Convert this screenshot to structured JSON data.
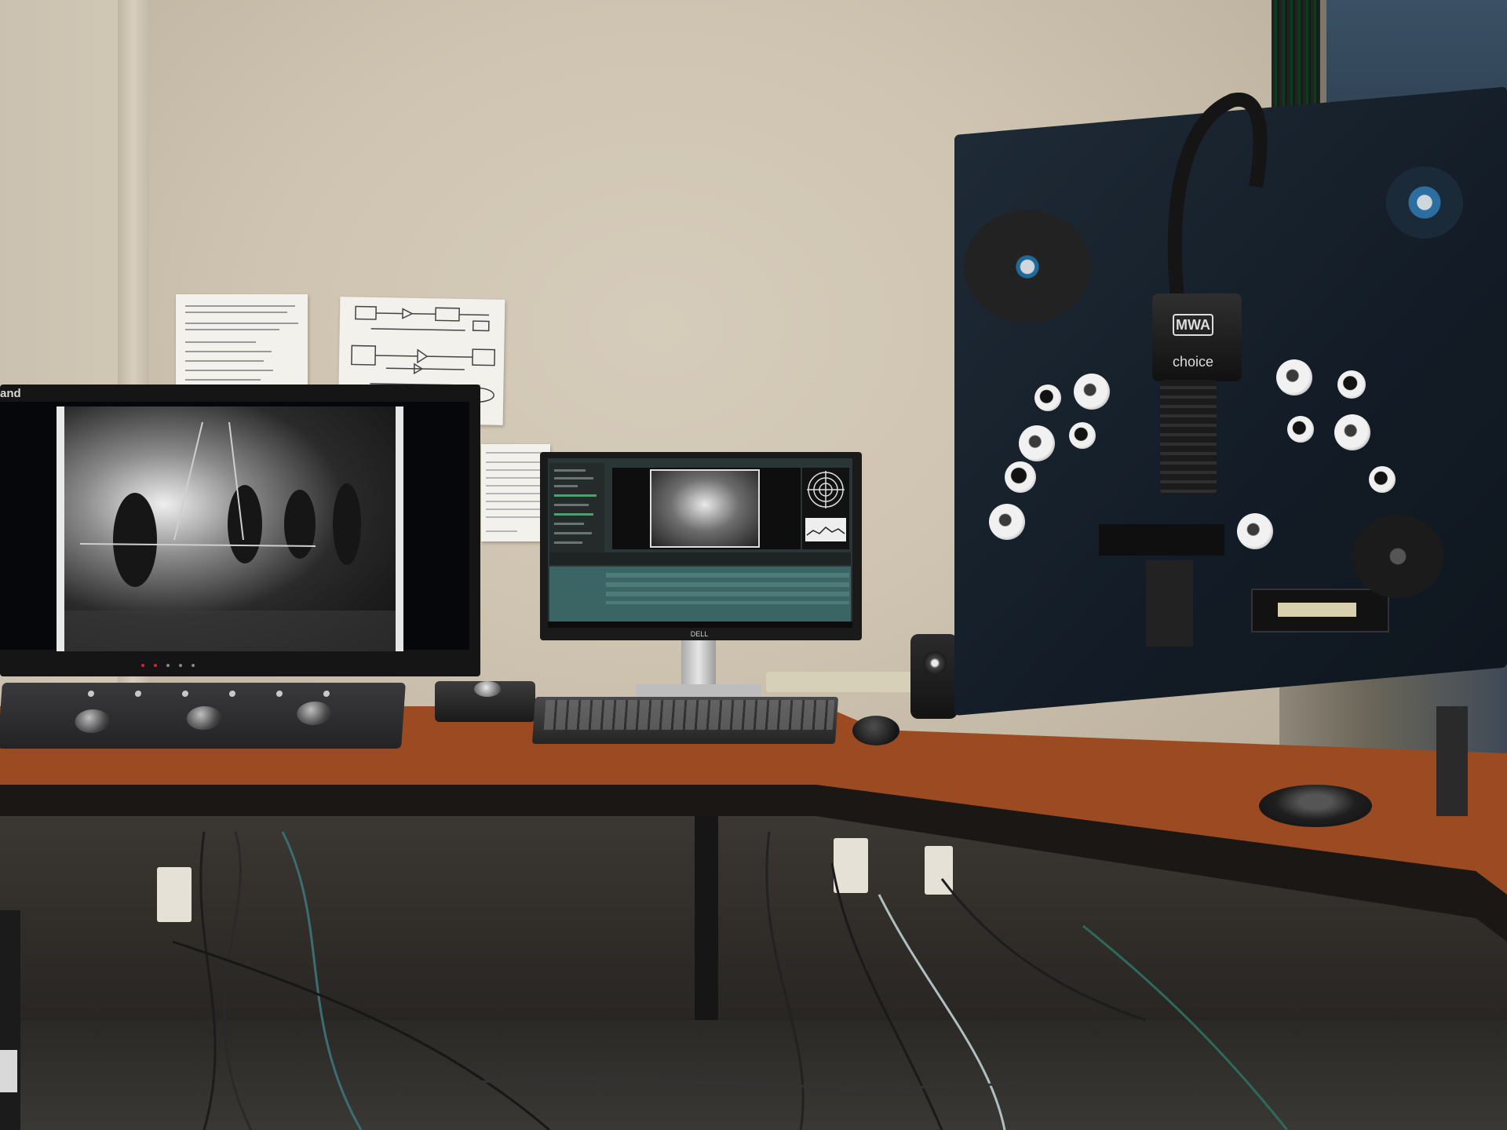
{
  "scene": "film scanning workstation",
  "left_monitor": {
    "brand_text": "and"
  },
  "film_scanner": {
    "camera_logo": "MWA",
    "camera_model": "choice"
  },
  "right_monitor": {
    "logo_text": "DELL"
  },
  "colors": {
    "wall": "#cfc5b4",
    "desk": "#9b4a22",
    "scanner_board": "#16202b",
    "app_timeline": "#3b6564",
    "reel_accent": "#1e6a9a"
  },
  "icons": [
    "film-reel-icon",
    "trackball-icon",
    "speaker-icon"
  ]
}
